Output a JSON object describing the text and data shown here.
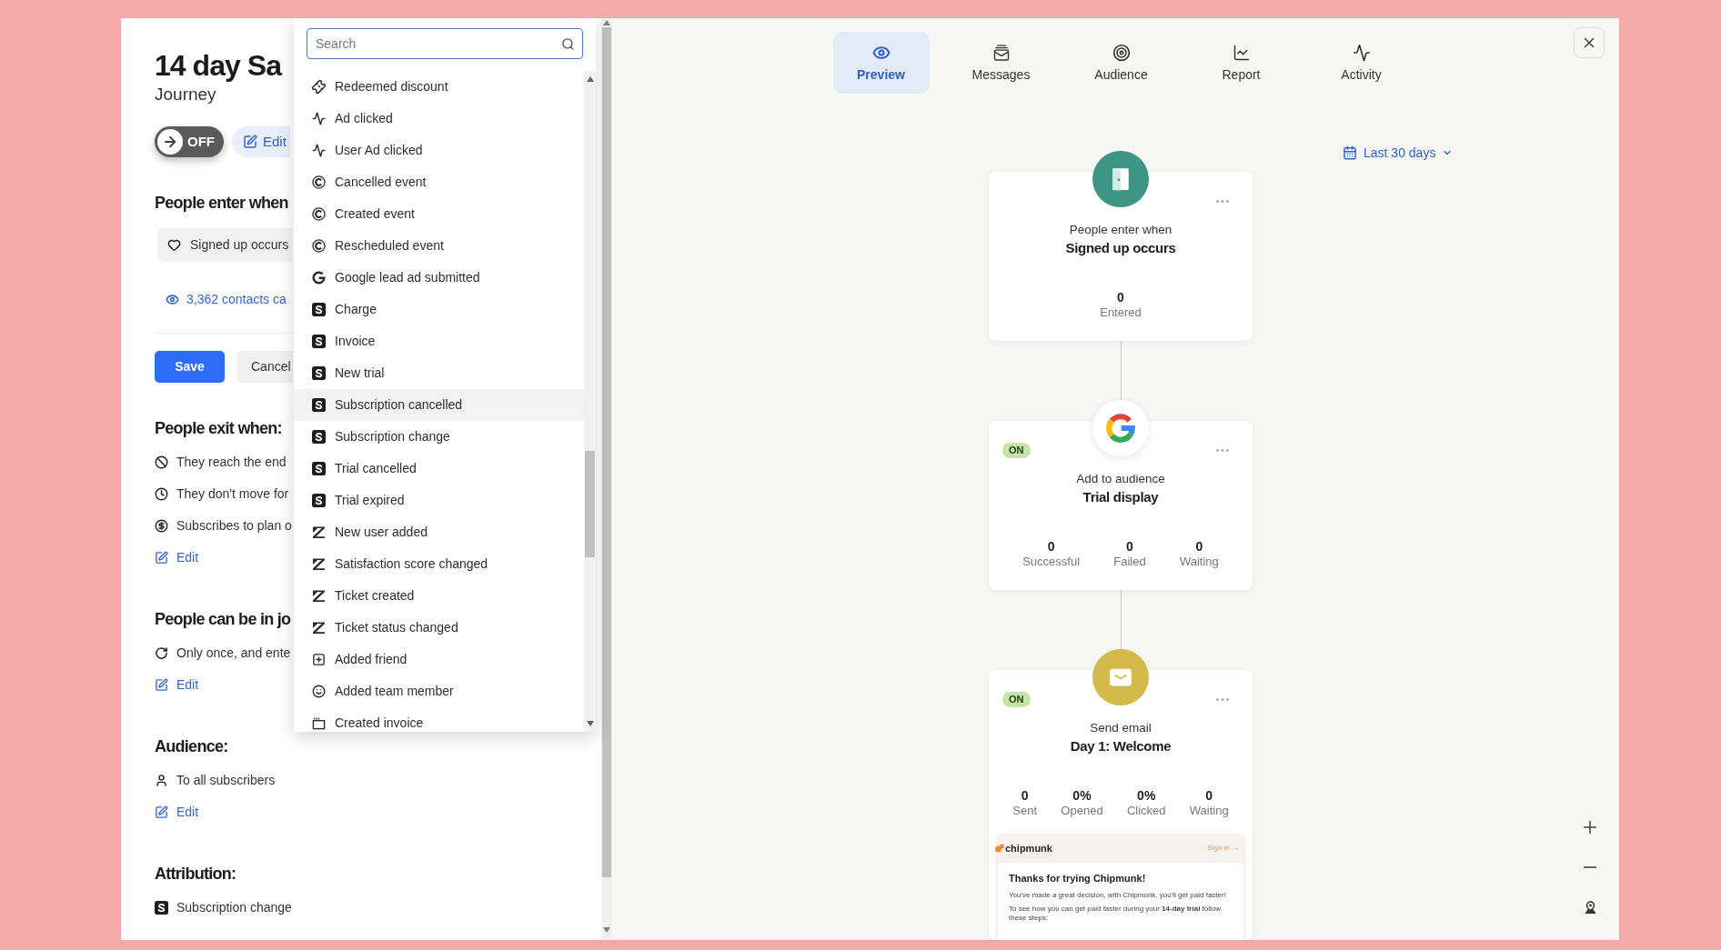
{
  "panel": {
    "title": "14 day Sa",
    "subtitle": "Journey",
    "toggle": {
      "label": "OFF",
      "on": false
    },
    "edit_button": "Edit",
    "entry": {
      "heading": "People enter when",
      "trigger": "Signed up occurs",
      "contacts_link": "3,362 contacts ca",
      "save_button": "Save",
      "cancel_button": "Cancel"
    },
    "sections": [
      {
        "heading": "People exit when:",
        "items": [
          {
            "kind": "ban",
            "text": "They reach the end"
          },
          {
            "kind": "clock",
            "text": "They don't move for"
          },
          {
            "kind": "plan",
            "text": "Subscribes to plan o"
          }
        ],
        "edit": "Edit"
      },
      {
        "heading": "People can be in jo",
        "items": [
          {
            "kind": "repeat",
            "text": "Only once, and ente"
          }
        ],
        "edit": "Edit"
      },
      {
        "heading": "Audience:",
        "items": [
          {
            "kind": "person",
            "text": "To all subscribers"
          }
        ],
        "edit": "Edit"
      },
      {
        "heading": "Attribution:",
        "items": [
          {
            "kind": "payment",
            "text": "Subscription change"
          }
        ]
      }
    ]
  },
  "dropdown": {
    "search": {
      "placeholder": "Search"
    },
    "items": [
      {
        "kind": "discount",
        "label": "Redeemed discount",
        "highlighted": false
      },
      {
        "kind": "ad",
        "label": "Ad clicked",
        "highlighted": false
      },
      {
        "kind": "ad",
        "label": "User Ad clicked",
        "highlighted": false
      },
      {
        "kind": "scheduling",
        "label": "Cancelled event",
        "highlighted": false
      },
      {
        "kind": "scheduling",
        "label": "Created event",
        "highlighted": false
      },
      {
        "kind": "scheduling",
        "label": "Rescheduled event",
        "highlighted": false
      },
      {
        "kind": "lead",
        "label": "Google lead ad submitted",
        "highlighted": false
      },
      {
        "kind": "billing",
        "label": "Charge",
        "highlighted": false
      },
      {
        "kind": "billing",
        "label": "Invoice",
        "highlighted": false
      },
      {
        "kind": "billing",
        "label": "New trial",
        "highlighted": false
      },
      {
        "kind": "billing",
        "label": "Subscription cancelled",
        "highlighted": true
      },
      {
        "kind": "billing",
        "label": "Subscription change",
        "highlighted": false
      },
      {
        "kind": "billing",
        "label": "Trial cancelled",
        "highlighted": false
      },
      {
        "kind": "billing",
        "label": "Trial expired",
        "highlighted": false
      },
      {
        "kind": "helpdesk",
        "label": "New user added",
        "highlighted": false
      },
      {
        "kind": "helpdesk",
        "label": "Satisfaction score changed",
        "highlighted": false
      },
      {
        "kind": "helpdesk",
        "label": "Ticket created",
        "highlighted": false
      },
      {
        "kind": "helpdesk",
        "label": "Ticket status changed",
        "highlighted": false
      },
      {
        "kind": "friend",
        "label": "Added friend",
        "highlighted": false
      },
      {
        "kind": "team",
        "label": "Added team member",
        "highlighted": false
      },
      {
        "kind": "invoice",
        "label": "Created invoice",
        "highlighted": false
      }
    ]
  },
  "canvas": {
    "tabs": [
      {
        "label": "Preview",
        "selected": true
      },
      {
        "label": "Messages",
        "selected": false
      },
      {
        "label": "Audience",
        "selected": false
      },
      {
        "label": "Report",
        "selected": false
      },
      {
        "label": "Activity",
        "selected": false
      }
    ],
    "date_range": "Last 30 days",
    "nodes": [
      {
        "kind": "entry",
        "caption": "People enter when",
        "title": "Signed up occurs",
        "stats": [
          {
            "value": "0",
            "label": "Entered"
          }
        ]
      },
      {
        "kind": "audience",
        "status": {
          "label": "ON",
          "on": true
        },
        "caption": "Add to audience",
        "title": "Trial display",
        "stats": [
          {
            "value": "0",
            "label": "Successful"
          },
          {
            "value": "0",
            "label": "Failed"
          },
          {
            "value": "0",
            "label": "Waiting"
          }
        ]
      },
      {
        "kind": "email",
        "status": {
          "label": "ON",
          "on": true
        },
        "caption": "Send email",
        "title": "Day 1: Welcome",
        "stats": [
          {
            "value": "0",
            "label": "Sent"
          },
          {
            "value": "0%",
            "label": "Opened"
          },
          {
            "value": "0%",
            "label": "Clicked"
          },
          {
            "value": "0",
            "label": "Waiting"
          }
        ],
        "preview": {
          "brand": "chipmunk",
          "link": "Sign in →",
          "heading": "Thanks for trying Chipmunk!",
          "paragraphs": [
            "You've made a great decision, with Chipmunk, you'll get paid faster!",
            "To see how you can get paid faster during your **14-day trial** follow these steps:"
          ]
        }
      }
    ]
  }
}
